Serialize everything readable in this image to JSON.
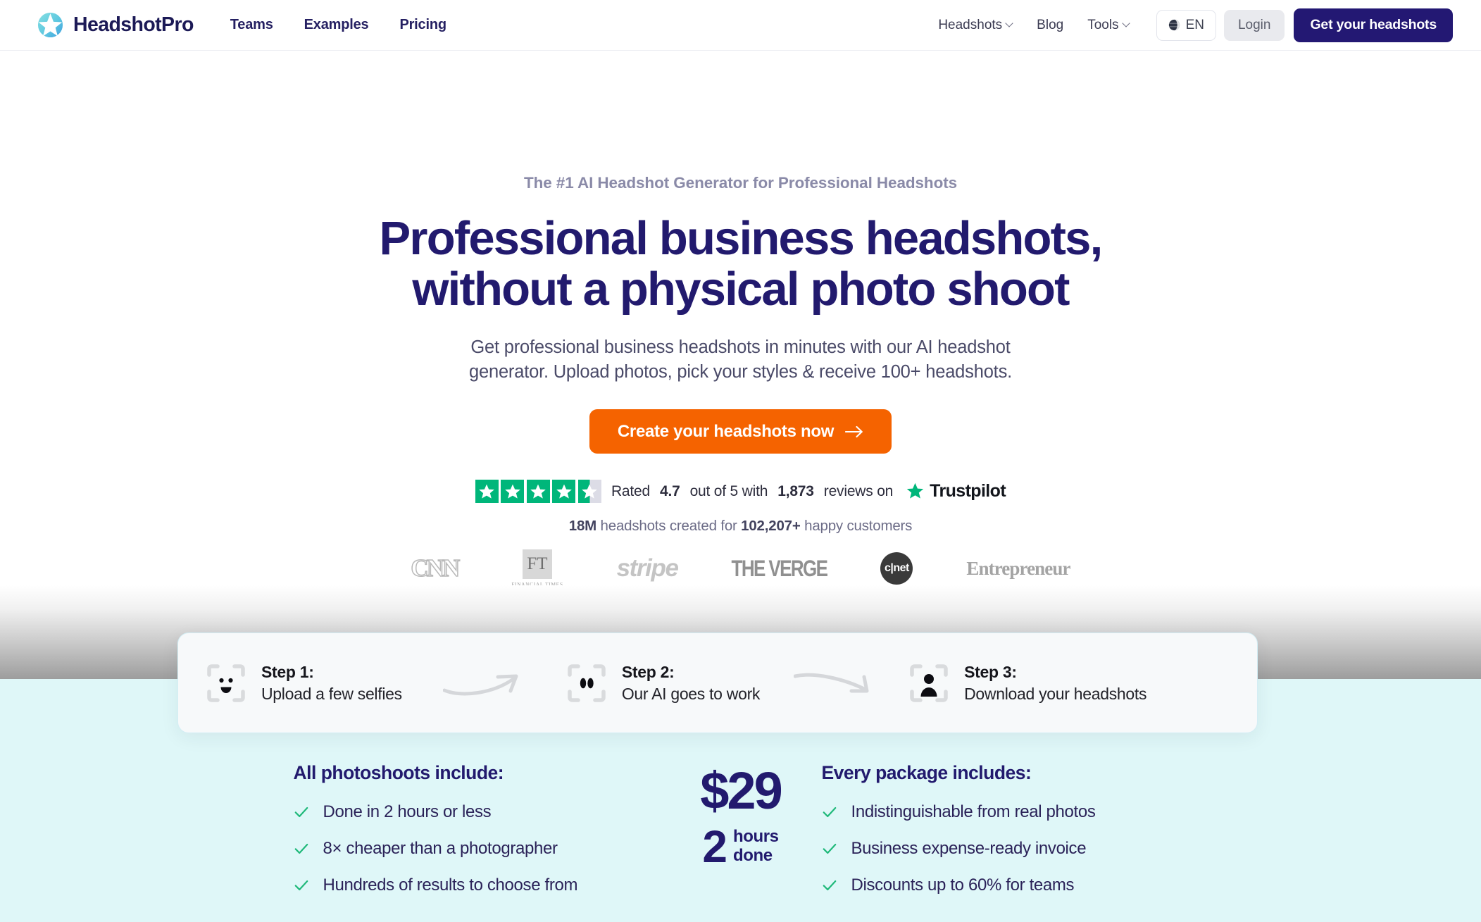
{
  "header": {
    "brand": "HeadshotPro",
    "logo_icon": "headshotpro-star-logo",
    "nav_left": [
      {
        "label": "Teams"
      },
      {
        "label": "Examples"
      },
      {
        "label": "Pricing"
      }
    ],
    "nav_right": [
      {
        "label": "Headshots",
        "has_caret": true
      },
      {
        "label": "Blog",
        "has_caret": false
      },
      {
        "label": "Tools",
        "has_caret": true
      }
    ],
    "language": {
      "code": "EN",
      "icon": "globe-icon"
    },
    "login_label": "Login",
    "cta_label": "Get your headshots"
  },
  "hero": {
    "eyebrow": "The #1 AI Headshot Generator for Professional Headshots",
    "heading_line1": "Professional business headshots,",
    "heading_line2": "without a physical photo shoot",
    "subtitle_line1": "Get professional business headshots in minutes with our AI headshot",
    "subtitle_line2": "generator. Upload photos, pick your styles & receive 100+ headshots.",
    "cta_label": "Create your headshots now",
    "cta_arrow_icon": "arrow-right-icon"
  },
  "rating": {
    "prefix": "Rated",
    "score": "4.7",
    "mid": "out of 5 with",
    "reviews": "1,873",
    "suffix": "reviews on",
    "brand": "Trustpilot",
    "brand_icon": "trustpilot-star-icon",
    "stars_filled": 4,
    "stars_total": 5,
    "star_color": "#00b67a"
  },
  "stats": {
    "headshots": "18M",
    "mid": "headshots created for",
    "customers": "102,207+",
    "suffix": "happy customers"
  },
  "press_logos": [
    {
      "name": "CNN",
      "icon": "cnn-logo"
    },
    {
      "name": "FT",
      "sub": "FINANCIAL TIMES",
      "icon": "financial-times-logo"
    },
    {
      "name": "stripe",
      "icon": "stripe-logo"
    },
    {
      "name": "THE VERGE",
      "icon": "the-verge-logo"
    },
    {
      "name": "c|net",
      "icon": "cnet-logo"
    },
    {
      "name": "Entrepreneur",
      "icon": "entrepreneur-logo"
    }
  ],
  "steps": [
    {
      "title": "Step 1:",
      "desc": "Upload a few selfies",
      "icon": "face-scan-smile-icon"
    },
    {
      "title": "Step 2:",
      "desc": "Our AI goes to work",
      "icon": "face-scan-processing-icon"
    },
    {
      "title": "Step 3:",
      "desc": "Download your headshots",
      "icon": "face-scan-person-icon"
    }
  ],
  "features": {
    "left": {
      "heading": "All photoshoots include:",
      "items": [
        "Done in 2 hours or less",
        "8× cheaper than a photographer",
        "Hundreds of results to choose from"
      ]
    },
    "price": {
      "amount": "$29",
      "duration_number": "2",
      "duration_word": "hours",
      "duration_state": "done"
    },
    "right": {
      "heading": "Every package includes:",
      "items": [
        "Indistinguishable from real photos",
        "Business expense-ready invoice",
        "Discounts up to 60% for teams"
      ]
    },
    "check_color": "#1fb97a"
  },
  "colors": {
    "brand_navy": "#221a6e",
    "cta_orange": "#f56300",
    "mint_bg": "#dff7f8",
    "nav_cta_navy": "#231873"
  }
}
